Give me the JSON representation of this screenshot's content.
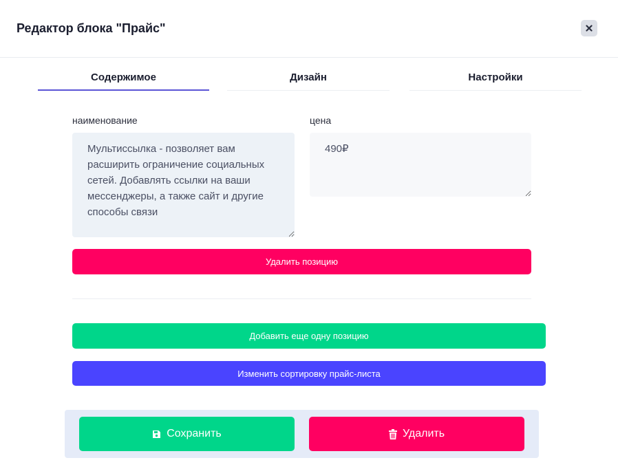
{
  "modal": {
    "title": "Редактор блока \"Прайс\"",
    "close_icon": "close-icon"
  },
  "tabs": [
    {
      "label": "Содержимое",
      "active": true
    },
    {
      "label": "Дизайн",
      "active": false
    },
    {
      "label": "Настройки",
      "active": false
    }
  ],
  "item": {
    "name_label": "наименование",
    "name_value": "Мультиссылка - позволяет вам расширить ограничение социальных сетей. Добавлять ссылки на ваши мессенджеры, а также сайт и другие способы связи",
    "price_label": "цена",
    "price_value": "490₽",
    "remove_label": "Удалить позицию"
  },
  "actions": {
    "add_label": "Добавить еще одну позицию",
    "sort_label": "Изменить сортировку прайс-листа"
  },
  "footer": {
    "save_label": "Сохранить",
    "save_icon": "floppy-disk-icon",
    "delete_label": "Удалить",
    "delete_icon": "trash-icon"
  },
  "colors": {
    "accent_tab": "#5a54d6",
    "danger": "#ff0061",
    "success": "#00d68a",
    "primary": "#4a44ff"
  }
}
